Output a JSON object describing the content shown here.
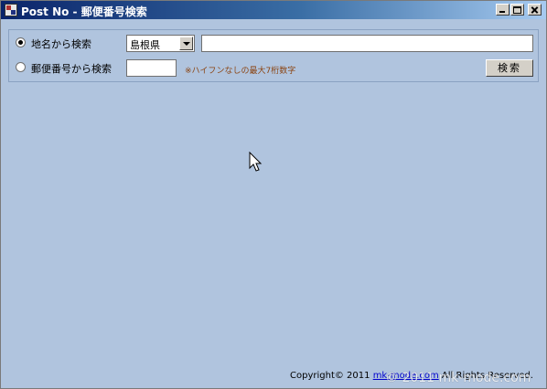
{
  "window": {
    "title": "Post No - 郵便番号検索",
    "controls": {
      "minimize": "minimize",
      "maximize": "maximize",
      "close": "close"
    }
  },
  "search_by_name": {
    "radio_label": "地名から検索",
    "checked": true,
    "prefecture_select": {
      "selected": "島根県"
    },
    "query_value": ""
  },
  "search_by_zip": {
    "radio_label": "郵便番号から検索",
    "checked": false,
    "zip_value": "",
    "hint": "※ハイフンなしの最大7桁数字"
  },
  "search_button": {
    "label": "検索"
  },
  "footer": {
    "copyright_prefix": "Copyright© 2011",
    "link_text": "mk-mode.com",
    "suffix": "All Rights Reserved."
  },
  "watermark": {
    "text": "© 2011 mk-mode.com"
  },
  "icons": {
    "app": "app-icon",
    "cursor": "mouse-pointer-icon"
  }
}
